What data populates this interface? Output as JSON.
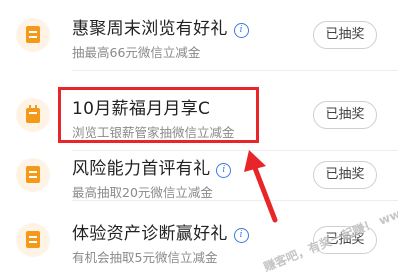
{
  "items": [
    {
      "title": "惠聚周末浏览有好礼",
      "has_info": true,
      "subtitle": "抽最高66元微信立减金",
      "button": "已抽奖"
    },
    {
      "title": "10月薪福月月享C",
      "has_info": false,
      "subtitle": "浏览工银薪管家抽微信立减金",
      "button": "已抽奖"
    },
    {
      "title": "风险能力首评有礼",
      "has_info": true,
      "subtitle": "最高抽取20元微信立减金",
      "button": "已抽奖"
    },
    {
      "title": "体验资产诊断赢好礼",
      "has_info": true,
      "subtitle": "有机会抽取5元微信立减金",
      "button": "已抽奖"
    }
  ],
  "info_glyph": "i",
  "annotation": {
    "color": "#e8262a"
  },
  "watermark": "赚客吧，有奖一起赚！ www.zuanke8.com",
  "colors": {
    "accent": "#f39a1a",
    "info": "#3a7be0"
  }
}
